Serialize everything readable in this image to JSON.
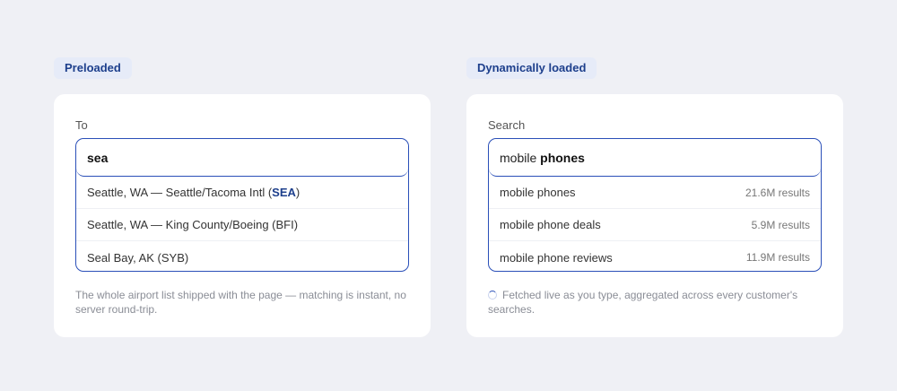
{
  "preloaded": {
    "tag": "Preloaded",
    "label": "To",
    "input_value": "sea",
    "options": [
      {
        "prefix": "Seattle, WA — Seattle/Tacoma Intl (",
        "code": "SEA",
        "suffix": ")"
      },
      {
        "text": "Seattle, WA — King County/Boeing (BFI)"
      },
      {
        "text": "Seal Bay, AK (SYB)"
      }
    ],
    "note": "The whole airport list shipped with the page — matching is instant, no server round-trip."
  },
  "dynamic": {
    "tag": "Dynamically loaded",
    "label": "Search",
    "input_typed": "mobile",
    "input_completion": "phones",
    "options": [
      {
        "text": "mobile phones",
        "count": "21.6M results"
      },
      {
        "text": "mobile phone deals",
        "count": "5.9M results"
      },
      {
        "text": "mobile phone reviews",
        "count": "11.9M results"
      }
    ],
    "note": "Fetched live as you type, aggregated across every customer's searches."
  },
  "colors": {
    "accent": "#2a4fb8",
    "tag_text": "#1d3f8c",
    "background": "#eff0f5"
  }
}
